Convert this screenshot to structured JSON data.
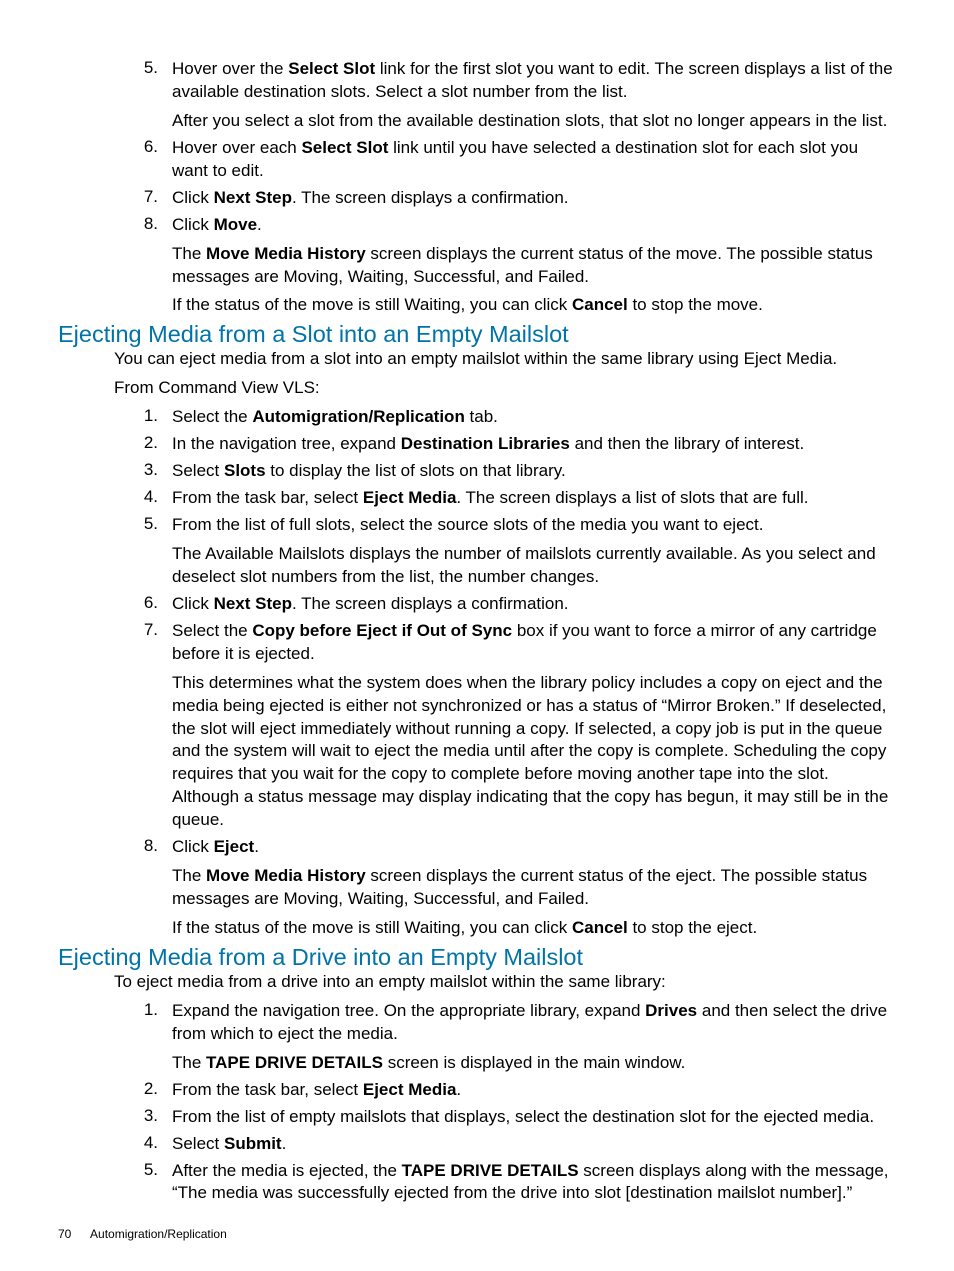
{
  "section1": {
    "steps": [
      {
        "num": "5.",
        "paras": [
          "Hover over the <b>Select Slot</b> link for the first slot you want to edit. The screen displays a list of the available destination slots. Select a slot number from the list.",
          "After you select a slot from the available destination slots, that slot no longer appears in the list."
        ]
      },
      {
        "num": "6.",
        "paras": [
          "Hover over each <b>Select Slot</b> link until you have selected a destination slot for each slot you want to edit."
        ]
      },
      {
        "num": "7.",
        "paras": [
          "Click <b>Next Step</b>. The screen displays a confirmation."
        ]
      },
      {
        "num": "8.",
        "paras": [
          "Click <b>Move</b>.",
          "The <b>Move Media History</b> screen displays the current status of the move. The possible status messages are Moving, Waiting, Successful, and Failed.",
          "If the status of the move is still Waiting, you can click <b>Cancel</b> to stop the move."
        ]
      }
    ]
  },
  "section2": {
    "heading": "Ejecting Media from a Slot into an Empty Mailslot",
    "intro": [
      "You can eject media from a slot into an empty mailslot within the same library using Eject Media.",
      "From Command View VLS:"
    ],
    "steps": [
      {
        "num": "1.",
        "paras": [
          "Select the <b>Automigration/Replication</b> tab."
        ]
      },
      {
        "num": "2.",
        "paras": [
          "In the navigation tree, expand <b>Destination Libraries</b> and then the library of interest."
        ]
      },
      {
        "num": "3.",
        "paras": [
          "Select <b>Slots</b> to display the list of slots on that library."
        ]
      },
      {
        "num": "4.",
        "paras": [
          "From the task bar, select <b>Eject Media</b>. The screen displays a list of slots that are full."
        ]
      },
      {
        "num": "5.",
        "paras": [
          "From the list of full slots, select the source slots of the media you want to eject.",
          "The Available Mailslots displays the number of mailslots currently available. As you select and deselect slot numbers from the list, the number changes."
        ]
      },
      {
        "num": "6.",
        "paras": [
          "Click <b>Next Step</b>. The screen displays a confirmation."
        ]
      },
      {
        "num": "7.",
        "paras": [
          "Select the <b>Copy before Eject if Out of Sync</b> box if you want to force a mirror of any cartridge before it is ejected.",
          "This determines what the system does when the library policy includes a copy on eject and the media being ejected is either not synchronized or has a status of “Mirror Broken.” If deselected, the slot will eject immediately without running a copy. If selected, a copy job is put in the queue and the system will wait to eject the media until after the copy is complete. Scheduling the copy requires that you wait for the copy to complete before moving another tape into the slot. Although a status message may display indicating that the copy has begun, it may still be in the queue."
        ]
      },
      {
        "num": "8.",
        "paras": [
          "Click <b>Eject</b>.",
          "The <b>Move Media History</b> screen displays the current status of the eject. The possible status messages are Moving, Waiting, Successful, and Failed.",
          "If the status of the move is still Waiting, you can click <b>Cancel</b> to stop the eject."
        ]
      }
    ]
  },
  "section3": {
    "heading": "Ejecting Media from a Drive into an Empty Mailslot",
    "intro": [
      "To eject media from a drive into an empty mailslot within the same library:"
    ],
    "steps": [
      {
        "num": "1.",
        "paras": [
          "Expand the navigation tree. On the appropriate library, expand <b>Drives</b> and then select the drive from which to eject the media.",
          "The <b>TAPE DRIVE DETAILS</b> screen is displayed in the main window."
        ]
      },
      {
        "num": "2.",
        "paras": [
          "From the task bar, select <b>Eject Media</b>."
        ]
      },
      {
        "num": "3.",
        "paras": [
          "From the list of empty mailslots that displays, select the destination slot for the ejected media."
        ]
      },
      {
        "num": "4.",
        "paras": [
          "Select <b>Submit</b>."
        ]
      },
      {
        "num": "5.",
        "paras": [
          "After the media is ejected, the <b>TAPE DRIVE DETAILS</b> screen displays along with the message, “The media was successfully ejected from the drive into slot [destination mailslot number].”"
        ]
      }
    ]
  },
  "footer": {
    "page": "70",
    "chapter": "Automigration/Replication"
  }
}
